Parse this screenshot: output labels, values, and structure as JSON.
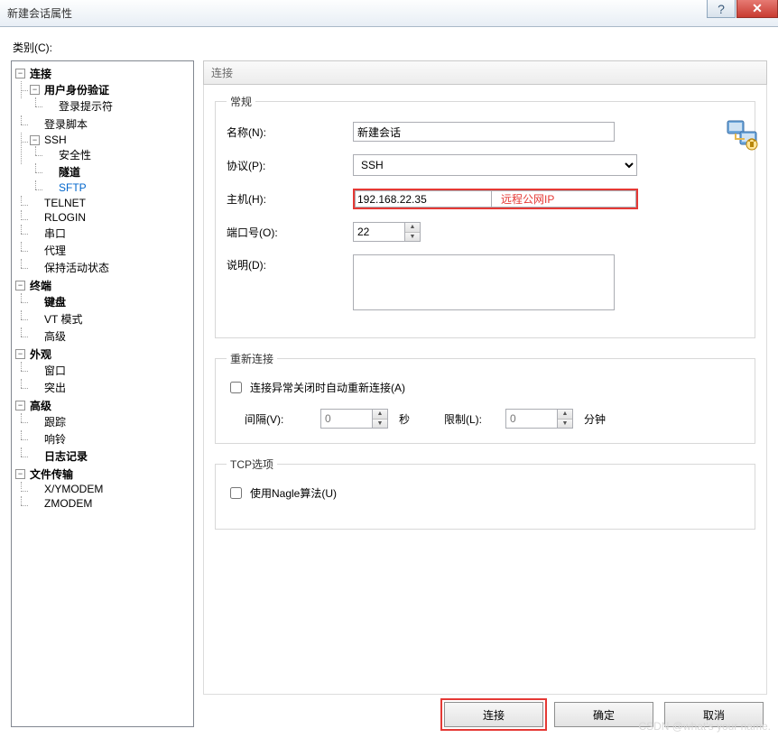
{
  "window": {
    "title": "新建会话属性"
  },
  "category_label": "类别(C):",
  "tree": {
    "connection": "连接",
    "user_auth": "用户身份验证",
    "login_prompt": "登录提示符",
    "login_script": "登录脚本",
    "ssh": "SSH",
    "security": "安全性",
    "tunnel": "隧道",
    "sftp": "SFTP",
    "telnet": "TELNET",
    "rlogin": "RLOGIN",
    "serial": "串口",
    "proxy": "代理",
    "keepalive": "保持活动状态",
    "terminal": "终端",
    "keyboard": "键盘",
    "vt": "VT 模式",
    "advanced_t": "高级",
    "appearance": "外观",
    "window_i": "窗口",
    "highlight": "突出",
    "advanced": "高级",
    "trace": "跟踪",
    "bell": "响铃",
    "logging": "日志记录",
    "file_transfer": "文件传输",
    "xymodem": "X/YMODEM",
    "zmodem": "ZMODEM"
  },
  "panel": {
    "title": "连接"
  },
  "general": {
    "legend": "常规",
    "name_label": "名称(N):",
    "name_value": "新建会话",
    "protocol_label": "协议(P):",
    "protocol_value": "SSH",
    "host_label": "主机(H):",
    "host_value": "192.168.22.35",
    "host_note": "远程公网IP",
    "port_label": "端口号(O):",
    "port_value": "22",
    "desc_label": "说明(D):"
  },
  "reconnect": {
    "legend": "重新连接",
    "auto_label": "连接异常关闭时自动重新连接(A)",
    "interval_label": "间隔(V):",
    "interval_value": "0",
    "interval_unit": "秒",
    "limit_label": "限制(L):",
    "limit_value": "0",
    "limit_unit": "分钟"
  },
  "tcp": {
    "legend": "TCP选项",
    "nagle_label": "使用Nagle算法(U)"
  },
  "footer": {
    "connect": "连接",
    "ok": "确定",
    "cancel": "取消"
  },
  "watermark": "CSDN @what's your name."
}
